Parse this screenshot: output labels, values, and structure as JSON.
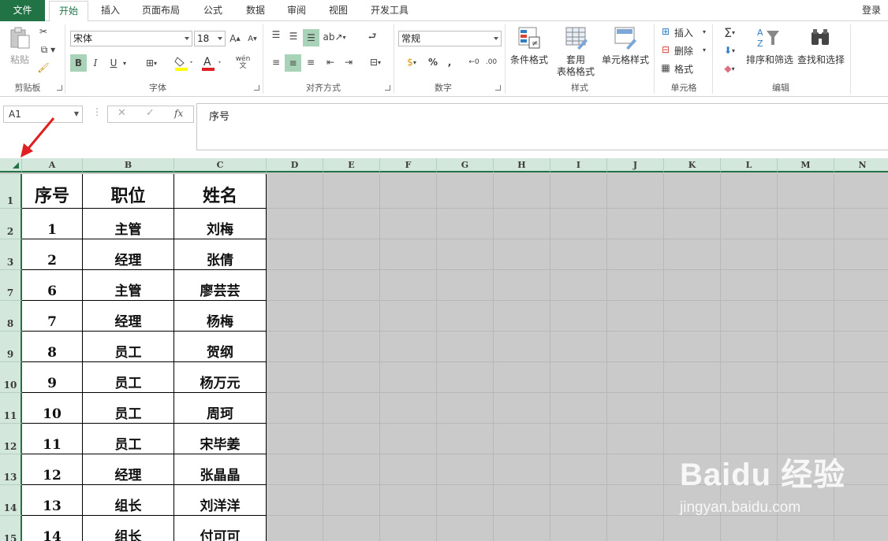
{
  "tabs": [
    {
      "label": "文件"
    },
    {
      "label": "开始"
    },
    {
      "label": "插入"
    },
    {
      "label": "页面布局"
    },
    {
      "label": "公式"
    },
    {
      "label": "数据"
    },
    {
      "label": "审阅"
    },
    {
      "label": "视图"
    },
    {
      "label": "开发工具"
    }
  ],
  "login": "登录",
  "ribbon": {
    "clipboard": {
      "paste": "粘贴",
      "label": "剪贴板"
    },
    "font": {
      "name": "宋体",
      "size": "18",
      "bold": "B",
      "italic": "I",
      "underline": "U",
      "label": "字体",
      "font_color": "#e02020",
      "fill_color": "#ffff00"
    },
    "alignment": {
      "label": "对齐方式"
    },
    "number": {
      "format": "常规",
      "percent": "%",
      "comma": ",",
      "label": "数字"
    },
    "styles": {
      "conditional": "条件格式",
      "table_line1": "套用",
      "table_line2": "表格格式",
      "cell_styles": "单元格样式",
      "label": "样式"
    },
    "cells": {
      "insert": "插入",
      "delete": "删除",
      "format": "格式",
      "label": "单元格"
    },
    "editing": {
      "sort": "排序和筛选",
      "find": "查找和选择",
      "label": "编辑"
    }
  },
  "formula_bar": {
    "name_box": "A1",
    "cancel": "✕",
    "enter": "✓",
    "fx": "fx",
    "content": "序号"
  },
  "columns": [
    "A",
    "B",
    "C",
    "D",
    "E",
    "F",
    "G",
    "H",
    "I",
    "J",
    "K",
    "L",
    "M",
    "N"
  ],
  "rows": [
    {
      "num": "1",
      "cells": [
        "序号",
        "职位",
        "姓名"
      ]
    },
    {
      "num": "2",
      "cells": [
        "1",
        "主管",
        "刘梅"
      ]
    },
    {
      "num": "3",
      "cells": [
        "2",
        "经理",
        "张倩"
      ]
    },
    {
      "num": "7",
      "cells": [
        "6",
        "主管",
        "廖芸芸"
      ]
    },
    {
      "num": "8",
      "cells": [
        "7",
        "经理",
        "杨梅"
      ]
    },
    {
      "num": "9",
      "cells": [
        "8",
        "员工",
        "贺纲"
      ]
    },
    {
      "num": "10",
      "cells": [
        "9",
        "员工",
        "杨万元"
      ]
    },
    {
      "num": "11",
      "cells": [
        "10",
        "员工",
        "周珂"
      ]
    },
    {
      "num": "12",
      "cells": [
        "11",
        "员工",
        "宋毕姜"
      ]
    },
    {
      "num": "13",
      "cells": [
        "12",
        "经理",
        "张晶晶"
      ]
    },
    {
      "num": "14",
      "cells": [
        "13",
        "组长",
        "刘洋洋"
      ]
    },
    {
      "num": "15",
      "cells": [
        "14",
        "组长",
        "付可可"
      ]
    }
  ],
  "colors": {
    "accent": "#217346",
    "header_bg": "#d3e7dc",
    "sheet_bg": "#cacaca",
    "annotation": "#e02020"
  },
  "watermark": {
    "logo": "Baidu 经验",
    "url": "jingyan.baidu.com"
  }
}
